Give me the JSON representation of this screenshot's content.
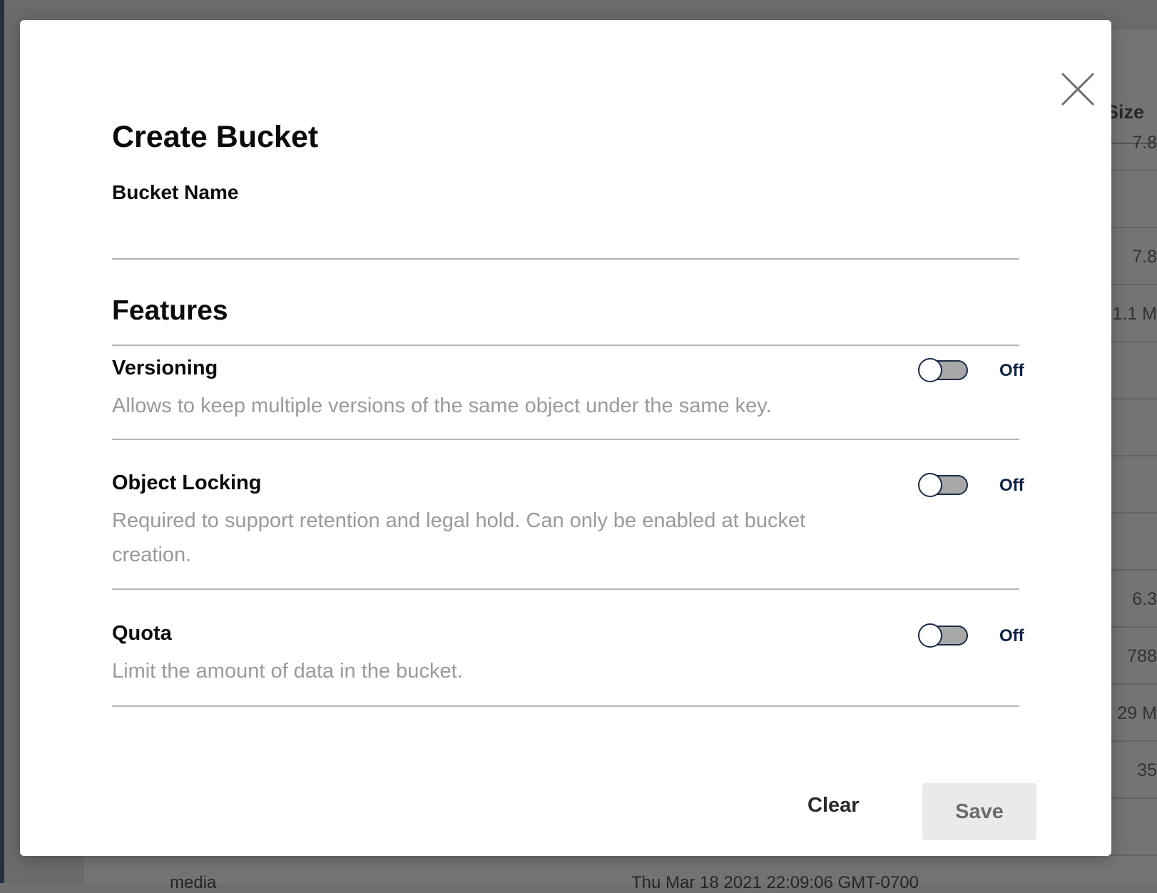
{
  "background": {
    "column_header": "Size",
    "row_values": [
      "7.8",
      "1.1 M",
      "",
      "",
      "",
      "",
      "6.3",
      "788",
      "29 M",
      "35"
    ],
    "bottom_left": "media",
    "bottom_right": "Thu Mar 18 2021 22:09:06 GMT-0700"
  },
  "modal": {
    "title": "Create Bucket",
    "bucket_name_label": "Bucket Name",
    "bucket_name_value": "",
    "features_title": "Features",
    "features": [
      {
        "title": "Versioning",
        "description": "Allows to keep multiple versions of the same object under the same key.",
        "state": "Off"
      },
      {
        "title": "Object Locking",
        "description": "Required to support retention and legal hold. Can only be enabled at bucket creation.",
        "state": "Off"
      },
      {
        "title": "Quota",
        "description": "Limit the amount of data in the bucket.",
        "state": "Off"
      }
    ],
    "clear_label": "Clear",
    "save_label": "Save"
  },
  "colors": {
    "toggle_border": "#1c2b4a",
    "toggle_track_off": "#a8a8a8",
    "state_text": "#0e2245",
    "save_disabled_bg": "#e9eaec"
  },
  "icons": {
    "close": "close-icon"
  }
}
